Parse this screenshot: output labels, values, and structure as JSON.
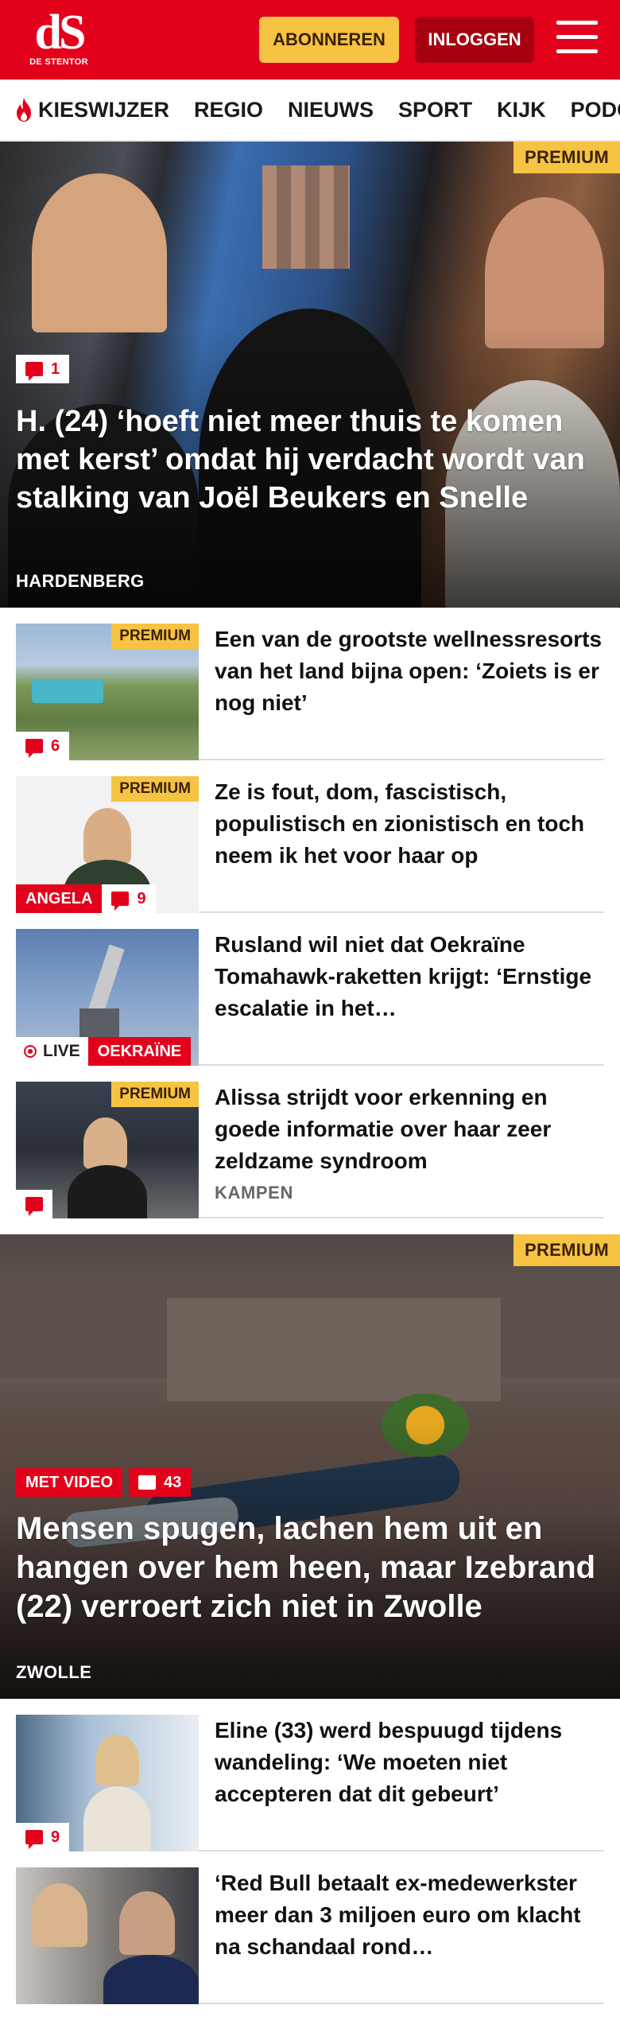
{
  "header": {
    "logo_mark": "dS",
    "logo_sub": "DE STENTOR",
    "subscribe_label": "ABONNEREN",
    "login_label": "INLOGGEN",
    "menu_icon": "hamburger-icon",
    "brand_color": "#e3001b",
    "subscribe_color": "#f6c343"
  },
  "nav": {
    "items": [
      "KIESWIJZER",
      "REGIO",
      "NIEUWS",
      "SPORT",
      "KIJK",
      "PODCAS"
    ],
    "first_icon": "flame-icon"
  },
  "hero1": {
    "premium": "PREMIUM",
    "comments": "1",
    "title": "H. (24) ‘hoeft niet meer thuis te komen met kerst’ omdat hij verdacht wordt van stalking van Joël Beukers en Snelle",
    "location": "HARDENBERG"
  },
  "articles1": [
    {
      "premium": "PREMIUM",
      "comments": "6",
      "title": "Een van de grootste wellnessre­sorts van het land bijna open: ‘Zoiets is er nog niet’"
    },
    {
      "premium": "PREMIUM",
      "label": "ANGELA",
      "comments": "9",
      "title": "Ze is fout, dom, fascistisch, populistisch en zionistisch en toch neem ik het voor haar op"
    },
    {
      "live": "LIVE",
      "label": "OEKRAÏNE",
      "title": "Rusland wil niet dat Oekraïne Tomahawk-raketten krijgt: ‘Ernstige escalatie in het…"
    },
    {
      "premium": "PREMIUM",
      "title": "Alissa strijdt voor erkenning en goede informatie over haar zeer zeldzame syndroom",
      "location": "KAMPEN"
    }
  ],
  "hero2": {
    "premium": "PREMIUM",
    "video_label": "MET VIDEO",
    "comments": "43",
    "title": "Mensen spugen, lachen hem uit en hangen over hem heen, maar Izebrand (22) verroert zich niet in Zwolle",
    "location": "ZWOLLE"
  },
  "articles2": [
    {
      "comments": "9",
      "title": "Eline (33) werd bespuugd tijdens wandeling: ‘We moeten niet accepteren dat dit gebeurt’"
    },
    {
      "title": "‘Red Bull betaalt ex-medewerk­ster meer dan 3 miljoen euro om klacht na schandaal rond…"
    }
  ]
}
